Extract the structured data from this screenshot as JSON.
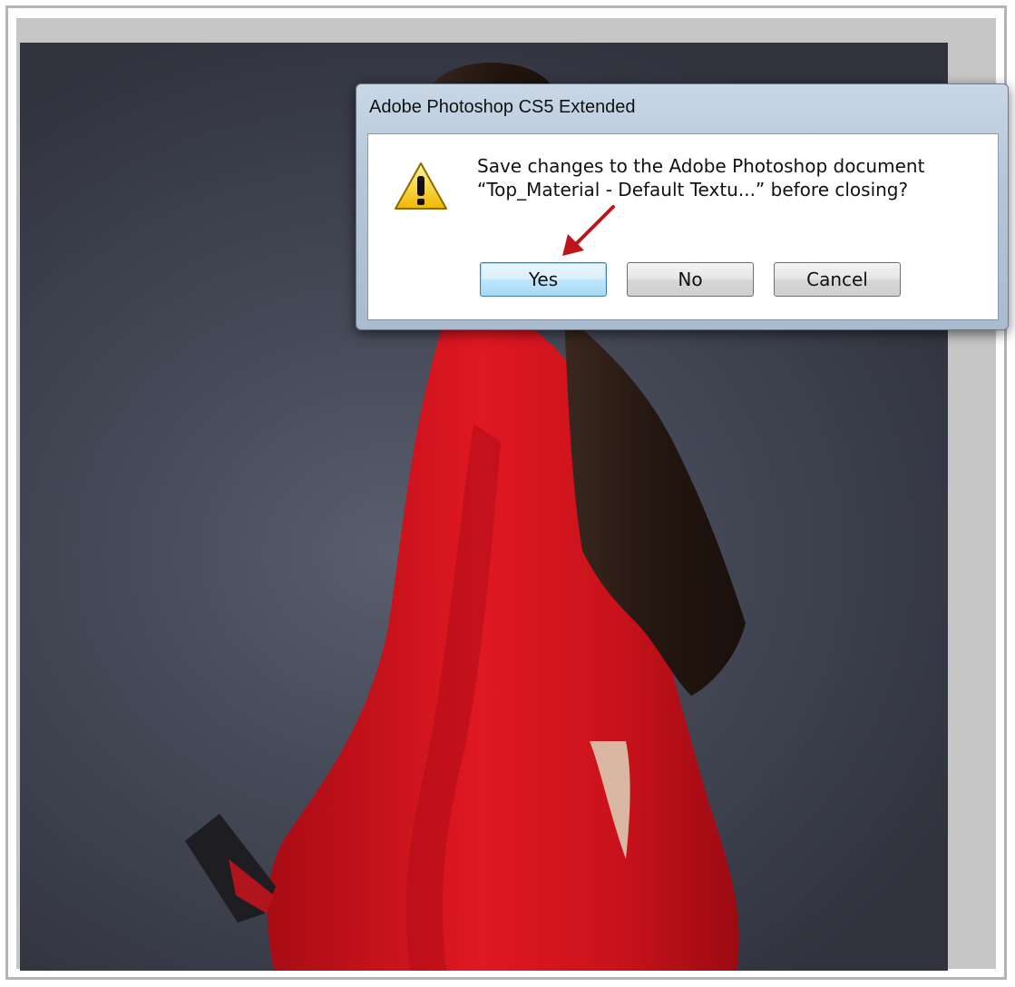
{
  "dialog": {
    "title": "Adobe Photoshop CS5 Extended",
    "icon": "warning-icon",
    "message_line1": "Save changes to the Adobe Photoshop document",
    "message_line2": "“Top_Material - Default Textu...” before closing?",
    "buttons": {
      "yes": "Yes",
      "no": "No",
      "cancel": "Cancel"
    },
    "default_button": "yes"
  },
  "colors": {
    "canvas_background": "#3c404c",
    "garment": "#d8141e",
    "hair": "#2a1a14",
    "annotation_arrow": "#c0141c",
    "default_button_border": "#3c7fb1"
  }
}
